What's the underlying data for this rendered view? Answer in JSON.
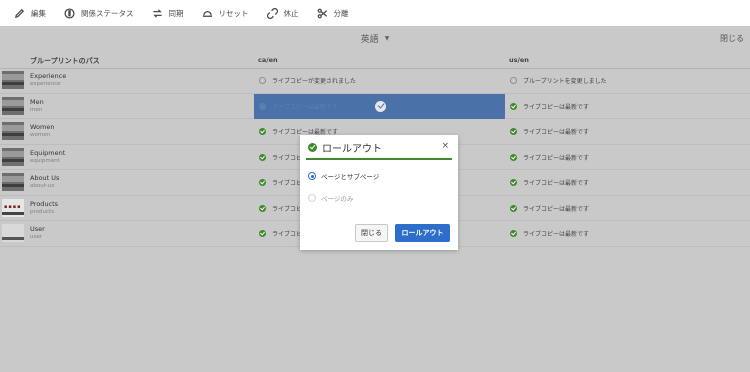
{
  "toolbar": {
    "items": [
      {
        "label": "編集",
        "icon": "pencil-icon"
      },
      {
        "label": "関係ステータス",
        "icon": "info-icon"
      },
      {
        "label": "同期",
        "icon": "sync-icon"
      },
      {
        "label": "リセット",
        "icon": "reset-icon"
      },
      {
        "label": "休止",
        "icon": "unlink-icon"
      },
      {
        "label": "分離",
        "icon": "detach-icon"
      }
    ]
  },
  "language": {
    "selected": "英語"
  },
  "close_label": "閉じる",
  "table": {
    "headers": {
      "path": "ブループリントのパス",
      "col1": "ca/en",
      "col2": "us/en"
    },
    "rows": [
      {
        "title": "Experience",
        "sub": "experience",
        "col1": "ライブコピーが変更されました",
        "col2": "ブループリントを変更しました",
        "col1_status": "pending",
        "col2_status": "pending"
      },
      {
        "title": "Men",
        "sub": "men",
        "col1": "ライブコピーは最新です",
        "col2": "ライブコピーは最新です",
        "col1_status": "selected",
        "col2_status": "ok"
      },
      {
        "title": "Women",
        "sub": "women",
        "col1": "ライブコピーは最新です",
        "col2": "ライブコピーは最新です",
        "col1_status": "ok",
        "col2_status": "ok"
      },
      {
        "title": "Equipment",
        "sub": "equipment",
        "col1": "ライブコピーは最新です",
        "col2": "ライブコピーは最新です",
        "col1_status": "ok",
        "col2_status": "ok"
      },
      {
        "title": "About Us",
        "sub": "about-us",
        "col1": "ライブコピーは最新です",
        "col2": "ライブコピーは最新です",
        "col1_status": "ok",
        "col2_status": "ok"
      },
      {
        "title": "Products",
        "sub": "products",
        "col1": "ライブコピーは最新です",
        "col2": "ライブコピーは最新です",
        "col1_status": "ok",
        "col2_status": "ok"
      },
      {
        "title": "User",
        "sub": "user",
        "col1": "ライブコピーは最新です",
        "col2": "ライブコピーは最新です",
        "col1_status": "ok",
        "col2_status": "ok"
      }
    ]
  },
  "dialog": {
    "title": "ロールアウト",
    "close_glyph": "×",
    "option_page_and_sub": "ページとサブページ",
    "option_page_only": "ページのみ",
    "selected_option": "ページとサブページ",
    "cancel_label": "閉じる",
    "submit_label": "ロールアウト"
  },
  "colors": {
    "accent": "#2c6ec9",
    "success": "#3f8a2a",
    "selection": "#4a72a8"
  }
}
